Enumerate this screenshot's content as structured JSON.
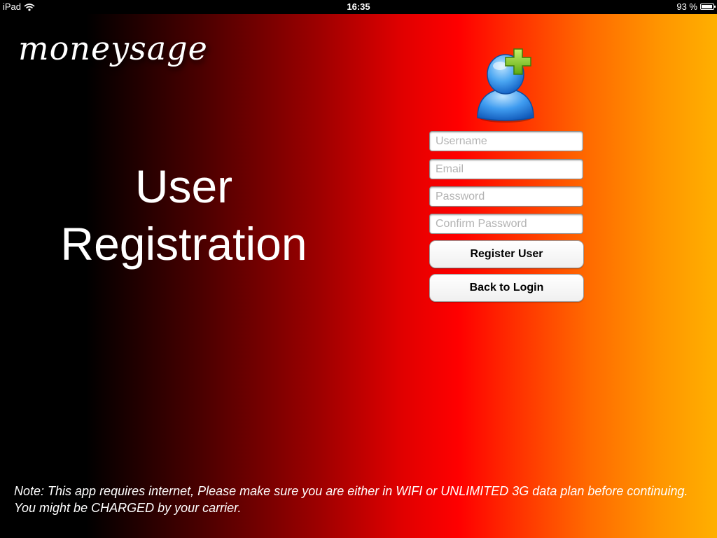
{
  "status_bar": {
    "device": "iPad",
    "time": "16:35",
    "battery": "93 %",
    "battery_level": 0.93,
    "icons": [
      "wifi-icon",
      "battery-icon"
    ]
  },
  "app": {
    "logo": "moneysage",
    "title_line1": "User",
    "title_line2": "Registration"
  },
  "form": {
    "username_placeholder": "Username",
    "email_placeholder": "Email",
    "password_placeholder": "Password",
    "confirm_password_placeholder": "Confirm Password",
    "register_button": "Register User",
    "back_button": "Back to Login",
    "icon": "add-user-icon"
  },
  "note": "Note: This app requires internet, Please make sure you are either in WIFI or UNLIMITED 3G data plan before continuing. You might be CHARGED by your carrier.",
  "colors": {
    "gradient": [
      "#000000",
      "#a00000",
      "#ff0000",
      "#ff6a00",
      "#ffb000"
    ],
    "text": "#ffffff",
    "icon_blue": "#2f8fe8",
    "icon_green": "#7ccb1a"
  }
}
